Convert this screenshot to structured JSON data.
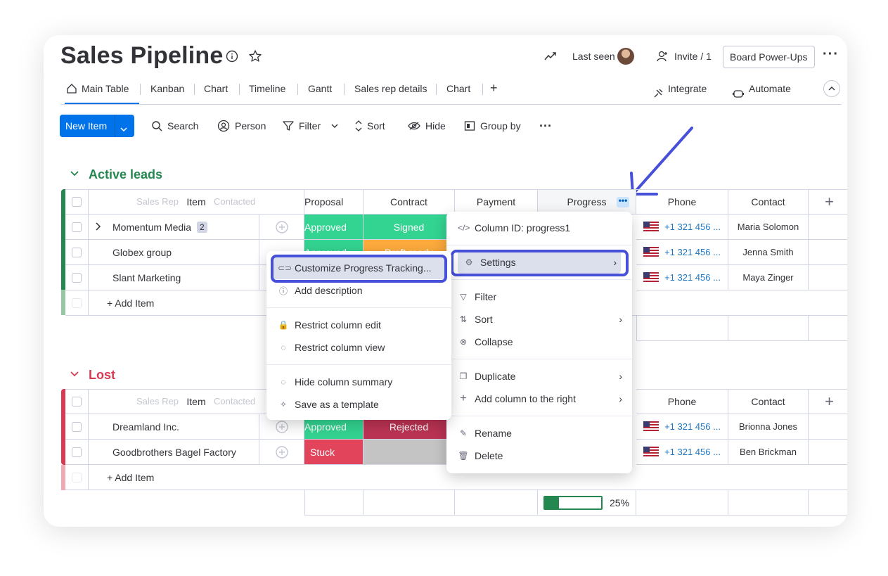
{
  "board": {
    "title": "Sales Pipeline"
  },
  "header": {
    "last_seen": "Last seen",
    "invite": "Invite / 1",
    "power_ups": "Board Power-Ups"
  },
  "tabs": [
    "Main Table",
    "Kanban",
    "Chart",
    "Timeline",
    "Gantt",
    "Sales rep details",
    "Chart"
  ],
  "tab_actions": {
    "integrate": "Integrate",
    "automate": "Automate"
  },
  "toolbar": {
    "new_item": "New Item",
    "search": "Search",
    "person": "Person",
    "filter": "Filter",
    "sort": "Sort",
    "hide": "Hide",
    "group_by": "Group by"
  },
  "colors": {
    "accent": "#0073ea",
    "active_group": "#258750",
    "lost_group": "#d83a52",
    "approved": "#00c875",
    "signed": "#00c875",
    "draft": "#fdab3d",
    "rejected": "#bb3354",
    "stuck": "#df2f4a",
    "highlight": "#4650d8"
  },
  "columns": {
    "item": "Item",
    "proposal": "Proposal",
    "contract": "Contract",
    "payment": "Payment",
    "progress": "Progress",
    "phone": "Phone",
    "contact": "Contact",
    "hidden_left": "Sales Rep",
    "hidden_right": "Contacted"
  },
  "groups": {
    "active": {
      "title": "Active leads",
      "rows": [
        {
          "item": "Momentum Media",
          "badge": "2",
          "proposal": "Approved",
          "contract": "Signed",
          "phone": "+1 321 456 ...",
          "contact": "Maria Solomon"
        },
        {
          "item": "Globex group",
          "proposal": "Approved",
          "contract": "Draft ready",
          "phone": "+1 321 456 ...",
          "contact": "Jenna Smith"
        },
        {
          "item": "Slant Marketing",
          "phone": "+1 321 456 ...",
          "contact": "Maya Zinger"
        }
      ],
      "add_item": "+ Add Item"
    },
    "lost": {
      "title": "Lost",
      "rows": [
        {
          "item": "Dreamland Inc.",
          "proposal": "Approved",
          "contract": "Rejected",
          "phone": "+1 321 456 ...",
          "contact": "Brionna Jones"
        },
        {
          "item": "Goodbrothers Bagel Factory",
          "proposal": "Stuck",
          "contract": "",
          "phone": "+1 321 456 ...",
          "contact": "Ben Brickman"
        }
      ],
      "add_item": "+ Add Item",
      "progress_summary": 0.25,
      "progress_label": "25%"
    }
  },
  "column_menu": {
    "column_id": "Column ID: progress1",
    "settings": "Settings",
    "filter": "Filter",
    "sort": "Sort",
    "collapse": "Collapse",
    "duplicate": "Duplicate",
    "add_right": "Add column to the right",
    "rename": "Rename",
    "delete": "Delete"
  },
  "settings_menu": {
    "customize": "Customize Progress Tracking...",
    "add_description": "Add description",
    "restrict_edit": "Restrict column edit",
    "restrict_view": "Restrict column view",
    "hide_summary": "Hide column summary",
    "save_template": "Save as a template"
  }
}
